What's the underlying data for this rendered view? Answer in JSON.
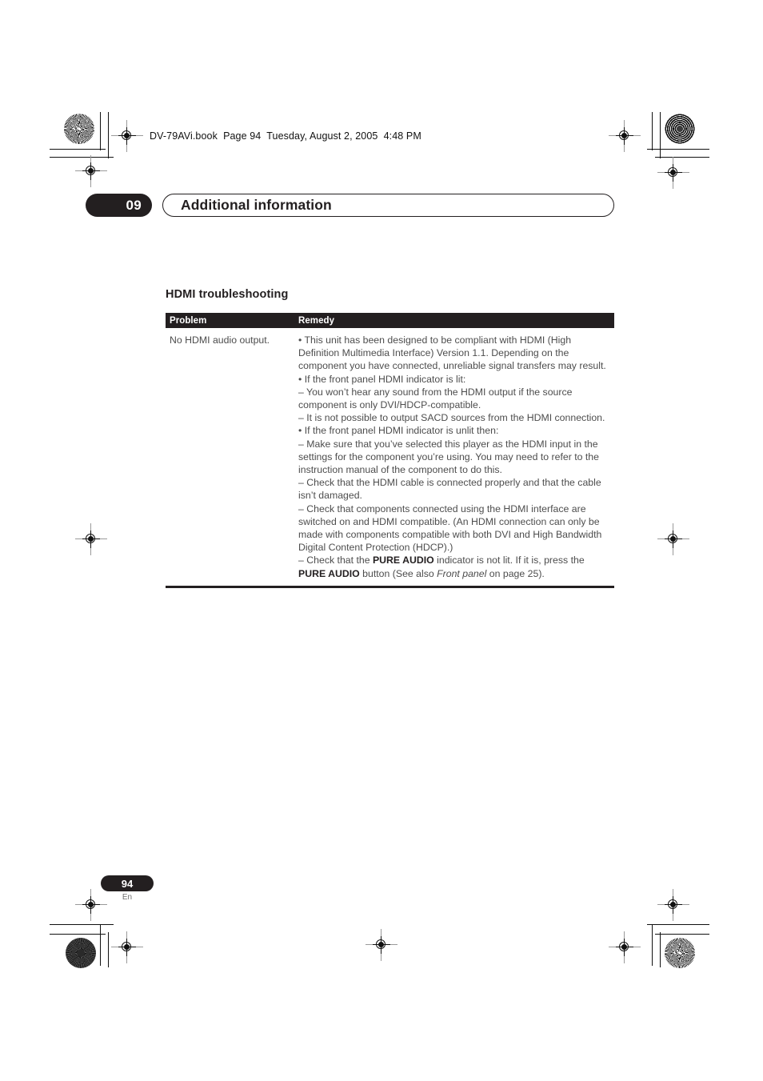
{
  "print_marks": {
    "registration_icon": "registration-target-icon",
    "density_patch_icon": "density-patch-icon",
    "crop_mark_icon": "crop-mark-icon"
  },
  "fileinfo": {
    "text": "DV-79AVi.book  Page 94  Tuesday, August 2, 2005  4:48 PM"
  },
  "chapter": {
    "number": "09",
    "title": "Additional information"
  },
  "section": {
    "heading": "HDMI troubleshooting"
  },
  "table": {
    "columns": [
      "Problem",
      "Remedy"
    ],
    "rows": [
      {
        "problem": "No HDMI audio output.",
        "remedy": [
          {
            "text": "• This unit has been designed to be compliant with HDMI (High Definition Multimedia Interface) Version 1.1. Depending on the component you have connected, unreliable signal transfers may result."
          },
          {
            "text": "• If the front panel HDMI indicator is lit:"
          },
          {
            "text": "– You won’t hear any sound from the HDMI output if the source component is only DVI/HDCP-compatible."
          },
          {
            "text": "– It is not possible to output SACD sources from the HDMI connection."
          },
          {
            "text": "• If the front panel HDMI indicator is unlit then:"
          },
          {
            "text": "– Make sure that you’ve selected this player as the HDMI input in the settings for the component you’re using. You may need to refer to the instruction manual of the component to do this."
          },
          {
            "text": "– Check that the HDMI cable is connected properly and that the cable isn’t damaged."
          },
          {
            "text": "– Check that components connected using the HDMI interface are switched on and HDMI compatible. (An HDMI connection can only be made with components compatible with both DVI and High Bandwidth Digital Content Protection (HDCP).)"
          },
          {
            "segments": [
              {
                "t": "– Check that the ",
                "style": "normal"
              },
              {
                "t": "PURE AUDIO",
                "style": "bold"
              },
              {
                "t": " indicator is not lit. If it is, press the ",
                "style": "normal"
              },
              {
                "t": "PURE AUDIO",
                "style": "bold"
              },
              {
                "t": " button (See also ",
                "style": "normal"
              },
              {
                "t": "Front panel",
                "style": "italic"
              },
              {
                "t": " on page 25).",
                "style": "normal"
              }
            ]
          }
        ]
      }
    ]
  },
  "footer": {
    "page_number": "94",
    "language": "En"
  },
  "colors": {
    "ink_black": "#231f20",
    "body_gray": "#4d4d4d",
    "page_white": "#ffffff"
  }
}
